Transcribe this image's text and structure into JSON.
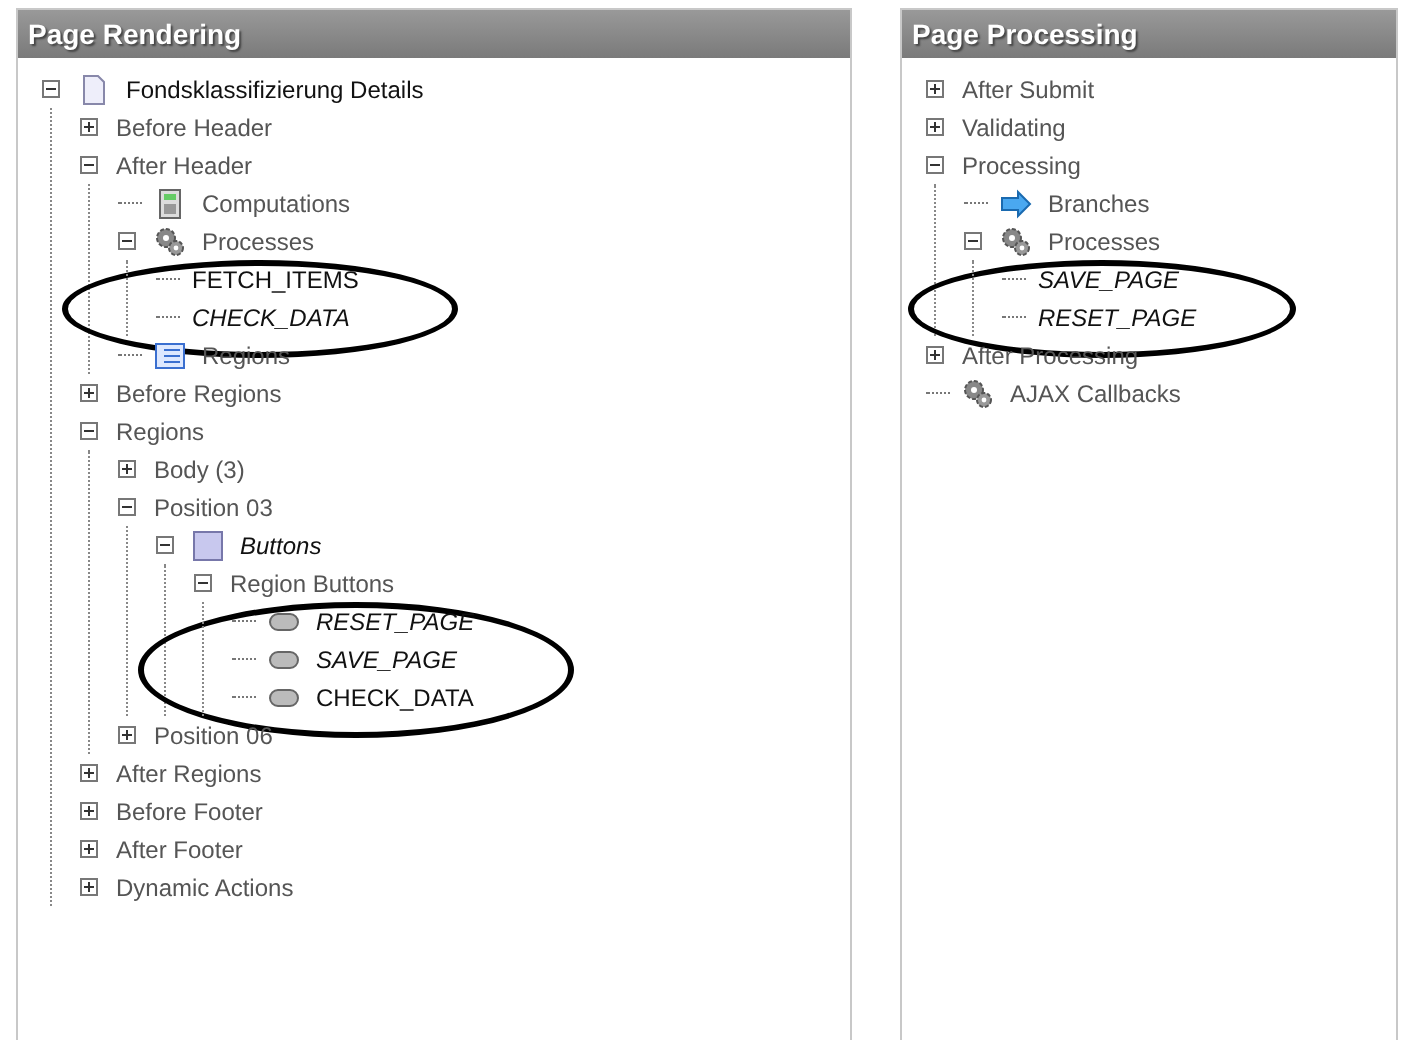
{
  "panels": [
    {
      "title": "Page Rendering",
      "tree": [
        {
          "label": "Fondsklassifizierung Details",
          "expanded": true,
          "kind": "page",
          "italic": false,
          "dark": true,
          "circled": false,
          "children": [
            {
              "label": "Before Header",
              "expanded": false,
              "italic": false,
              "dark": false,
              "circled": false
            },
            {
              "label": "After Header",
              "expanded": true,
              "italic": false,
              "dark": false,
              "circled": false,
              "children": [
                {
                  "label": "Computations",
                  "kind": "calculator",
                  "italic": false,
                  "dark": false,
                  "circled": false
                },
                {
                  "label": "Processes",
                  "expanded": true,
                  "kind": "gears",
                  "italic": false,
                  "dark": false,
                  "circled": true,
                  "children": [
                    {
                      "label": "FETCH_ITEMS",
                      "italic": false,
                      "dark": true,
                      "circled": false
                    },
                    {
                      "label": "CHECK_DATA",
                      "italic": true,
                      "dark": true,
                      "circled": false
                    }
                  ]
                },
                {
                  "label": "Regions",
                  "kind": "regions",
                  "italic": false,
                  "dark": false,
                  "circled": false
                }
              ]
            },
            {
              "label": "Before Regions",
              "expanded": false,
              "italic": false,
              "dark": false,
              "circled": false
            },
            {
              "label": "Regions",
              "expanded": true,
              "italic": false,
              "dark": false,
              "circled": false,
              "children": [
                {
                  "label": "Body (3)",
                  "expanded": false,
                  "italic": false,
                  "dark": false,
                  "circled": false
                },
                {
                  "label": "Position 03",
                  "expanded": true,
                  "italic": false,
                  "dark": false,
                  "circled": false,
                  "children": [
                    {
                      "label": "Buttons",
                      "expanded": true,
                      "kind": "region",
                      "italic": true,
                      "dark": true,
                      "circled": false,
                      "children": [
                        {
                          "label": "Region Buttons",
                          "expanded": true,
                          "italic": false,
                          "dark": false,
                          "circled": true,
                          "children": [
                            {
                              "label": "RESET_PAGE",
                              "kind": "button",
                              "italic": true,
                              "dark": true,
                              "circled": false
                            },
                            {
                              "label": "SAVE_PAGE",
                              "kind": "button",
                              "italic": true,
                              "dark": true,
                              "circled": false
                            },
                            {
                              "label": "CHECK_DATA",
                              "kind": "button",
                              "italic": false,
                              "dark": true,
                              "circled": false
                            }
                          ]
                        }
                      ]
                    }
                  ]
                },
                {
                  "label": "Position 06",
                  "expanded": false,
                  "italic": false,
                  "dark": false,
                  "circled": false
                }
              ]
            },
            {
              "label": "After Regions",
              "expanded": false,
              "italic": false,
              "dark": false,
              "circled": false
            },
            {
              "label": "Before Footer",
              "expanded": false,
              "italic": false,
              "dark": false,
              "circled": false
            },
            {
              "label": "After Footer",
              "expanded": false,
              "italic": false,
              "dark": false,
              "circled": false
            },
            {
              "label": "Dynamic Actions",
              "expanded": false,
              "italic": false,
              "dark": false,
              "circled": false
            }
          ]
        }
      ]
    },
    {
      "title": "Page Processing",
      "tree": [
        {
          "label": "After Submit",
          "expanded": false,
          "italic": false,
          "dark": false,
          "circled": false
        },
        {
          "label": "Validating",
          "expanded": false,
          "italic": false,
          "dark": false,
          "circled": false
        },
        {
          "label": "Processing",
          "expanded": true,
          "italic": false,
          "dark": false,
          "circled": false,
          "children": [
            {
              "label": "Branches",
              "kind": "arrow",
              "italic": false,
              "dark": false,
              "circled": false
            },
            {
              "label": "Processes",
              "expanded": true,
              "kind": "gears",
              "italic": false,
              "dark": false,
              "circled": true,
              "children": [
                {
                  "label": "SAVE_PAGE",
                  "italic": true,
                  "dark": true,
                  "circled": false
                },
                {
                  "label": "RESET_PAGE",
                  "italic": true,
                  "dark": true,
                  "circled": false
                }
              ]
            }
          ]
        },
        {
          "label": "After Processing",
          "expanded": false,
          "italic": false,
          "dark": false,
          "circled": false
        },
        {
          "label": "AJAX Callbacks",
          "kind": "gears",
          "italic": false,
          "dark": false,
          "circled": false
        }
      ]
    }
  ]
}
